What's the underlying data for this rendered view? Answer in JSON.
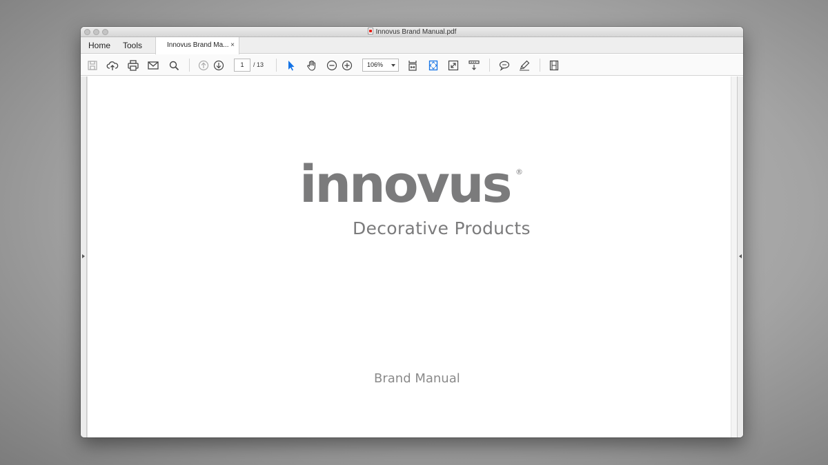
{
  "window": {
    "title": "Innovus Brand Manual.pdf"
  },
  "tabs": {
    "home": "Home",
    "tools": "Tools",
    "document_tab": "Innovus Brand Ma...",
    "close_glyph": "×"
  },
  "toolbar": {
    "icons": [
      "save-icon",
      "upload-cloud-icon",
      "print-icon",
      "email-icon",
      "search-icon",
      "previous-page-icon",
      "next-page-icon",
      "select-pointer-icon",
      "hand-icon",
      "zoom-out-icon",
      "zoom-in-icon",
      "fit-width-icon",
      "fit-page-icon",
      "fullscreen-icon",
      "scroll-mode-icon",
      "comment-icon",
      "highlight-icon",
      "filmstrip-icon"
    ],
    "current_page": "1",
    "page_total": "/  13",
    "zoom": "106%"
  },
  "document": {
    "logo_text": "innovus",
    "registered_mark": "®",
    "subtitle": "Decorative Products",
    "footer_title": "Brand Manual"
  },
  "colors": {
    "accent_blue": "#1473e6",
    "logo_gray": "#7b7b7c"
  }
}
